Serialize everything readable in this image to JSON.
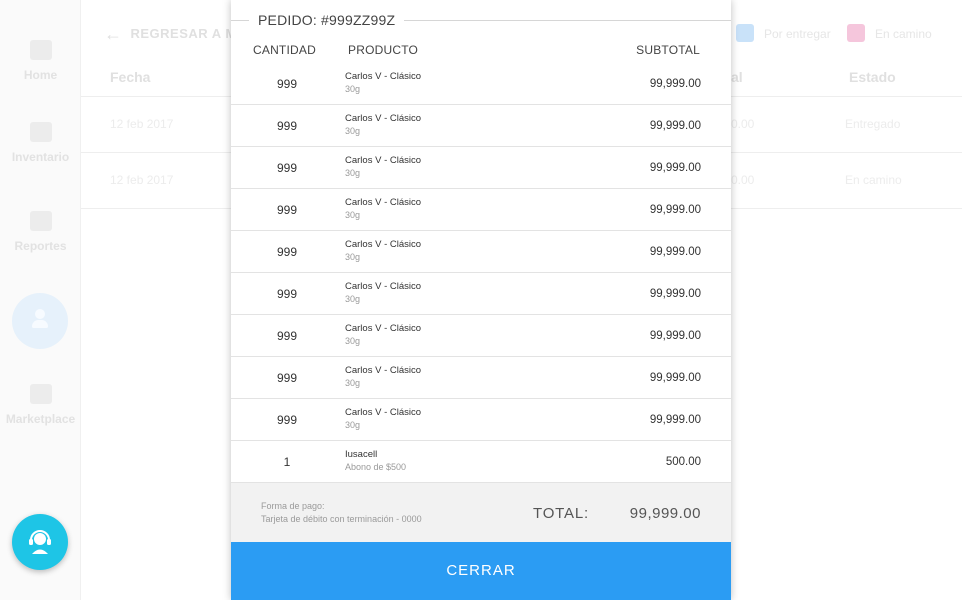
{
  "colors": {
    "accent": "#2b9cf3",
    "fab": "#1ec5e6",
    "chip_checked": "#c9e2f9",
    "chip_checked2": "#f5c6dc"
  },
  "sidebar": {
    "items": [
      {
        "label": "Home",
        "icon": "home-icon"
      },
      {
        "label": "Inventario",
        "icon": "inventory-icon"
      },
      {
        "label": "Reportes",
        "icon": "reports-icon"
      },
      {
        "label": "Marketplace",
        "icon": "basket-icon"
      }
    ],
    "profile_icon": "user-icon",
    "support_icon": "support-agent-icon"
  },
  "background": {
    "back_link": "REGRESAR A M",
    "filters": [
      {
        "label": "Por entregar"
      },
      {
        "label": "En camino"
      }
    ],
    "table_headers": {
      "fecha": "Fecha",
      "total": "al",
      "estado": "Estado"
    },
    "rows": [
      {
        "fecha": "12 feb 2017",
        "total": "0.00",
        "estado": "Entregado"
      },
      {
        "fecha": "12 feb 2017",
        "total": "0.00",
        "estado": "En camino"
      }
    ]
  },
  "modal": {
    "title": "PEDIDO: #999ZZ99Z",
    "columns": {
      "quantity": "CANTIDAD",
      "product": "PRODUCTO",
      "subtotal": "SUBTOTAL"
    },
    "items": [
      {
        "qty": "999",
        "name": "Carlos V - Clásico",
        "desc": "30g",
        "subtotal": "99,999.00"
      },
      {
        "qty": "999",
        "name": "Carlos V - Clásico",
        "desc": "30g",
        "subtotal": "99,999.00"
      },
      {
        "qty": "999",
        "name": "Carlos V - Clásico",
        "desc": "30g",
        "subtotal": "99,999.00"
      },
      {
        "qty": "999",
        "name": "Carlos V - Clásico",
        "desc": "30g",
        "subtotal": "99,999.00"
      },
      {
        "qty": "999",
        "name": "Carlos V - Clásico",
        "desc": "30g",
        "subtotal": "99,999.00"
      },
      {
        "qty": "999",
        "name": "Carlos V - Clásico",
        "desc": "30g",
        "subtotal": "99,999.00"
      },
      {
        "qty": "999",
        "name": "Carlos V - Clásico",
        "desc": "30g",
        "subtotal": "99,999.00"
      },
      {
        "qty": "999",
        "name": "Carlos V - Clásico",
        "desc": "30g",
        "subtotal": "99,999.00"
      },
      {
        "qty": "999",
        "name": "Carlos V - Clásico",
        "desc": "30g",
        "subtotal": "99,999.00"
      },
      {
        "qty": "1",
        "name": "Iusacell",
        "desc": "Abono de $500",
        "subtotal": "500.00"
      }
    ],
    "payment_label": "Forma de pago:",
    "payment_value": "Tarjeta de débito con terminación - 0000",
    "total_label": "TOTAL:",
    "total_value": "99,999.00",
    "close_label": "CERRAR"
  }
}
